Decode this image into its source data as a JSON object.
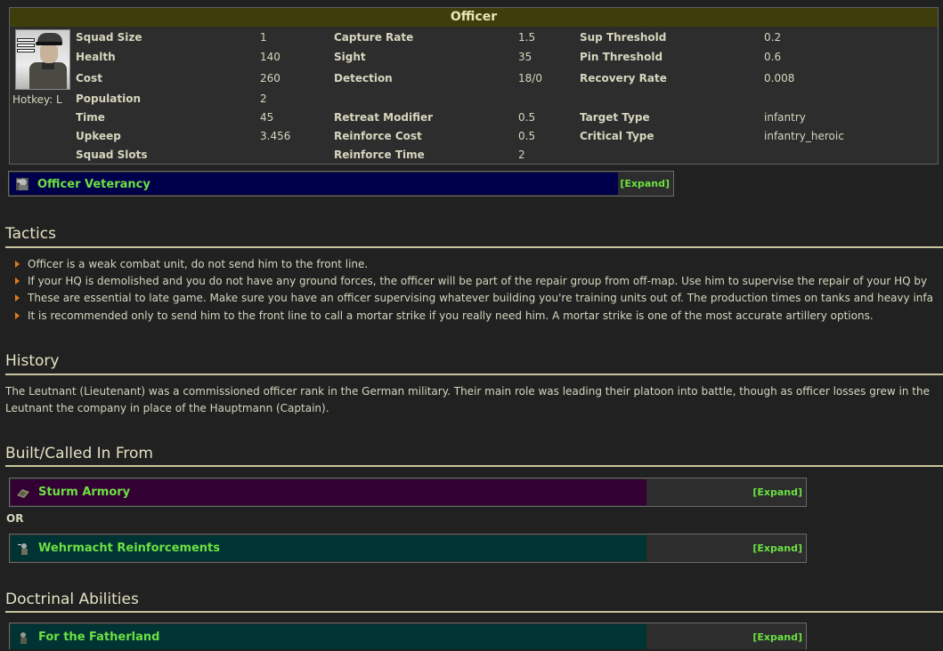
{
  "unit": {
    "title": "Officer",
    "hotkey": "Hotkey: L",
    "stats": {
      "col1": [
        {
          "label": "Squad Size",
          "value": "1"
        },
        {
          "label": "Health",
          "value": "140"
        },
        {
          "label": "Cost",
          "value": "260"
        },
        {
          "label": "Population",
          "value": "2"
        },
        {
          "label": "Time",
          "value": "45"
        },
        {
          "label": "Upkeep",
          "value": "3.456"
        },
        {
          "label": "Squad Slots",
          "value": ""
        }
      ],
      "col2": [
        {
          "label": "Capture Rate",
          "value": "1.5"
        },
        {
          "label": "Sight",
          "value": "35"
        },
        {
          "label": "Detection",
          "value": "18/0"
        },
        {
          "label": "Retreat Modifier",
          "value": "0.5"
        },
        {
          "label": "Reinforce Cost",
          "value": "0.5"
        },
        {
          "label": "Reinforce Time",
          "value": "2"
        }
      ],
      "col3": [
        {
          "label": "Sup Threshold",
          "value": "0.2"
        },
        {
          "label": "Pin Threshold",
          "value": "0.6"
        },
        {
          "label": "Recovery Rate",
          "value": "0.008"
        },
        {
          "label": "Target Type",
          "value": "infantry"
        },
        {
          "label": "Critical Type",
          "value": "infantry_heroic"
        }
      ]
    }
  },
  "veterancy": {
    "name": "Officer Veterancy",
    "expand": "[Expand]",
    "color": "#00004a"
  },
  "tactics": {
    "heading": "Tactics",
    "items": [
      "Officer is a weak combat unit, do not send him to the front line.",
      "If your HQ is demolished and you do not have any ground forces, the officer will be part of the repair group from off-map. Use him to supervise the repair of your HQ by",
      "These are essential to late game. Make sure you have an officer supervising whatever building you're training units out of. The production times on tanks and heavy infa",
      "It is recommended only to send him to the front line to call a mortar strike if you really need him. A mortar strike is one of the most accurate artillery options."
    ]
  },
  "history": {
    "heading": "History",
    "lines": [
      "The Leutnant (Lieutenant) was a commissioned officer rank in the German military. Their main role was leading their platoon into battle, though as officer losses grew in the",
      "Leutnant the company in place of the Hauptmann (Captain)."
    ]
  },
  "built": {
    "heading": "Built/Called In From",
    "or": "OR",
    "items": [
      {
        "name": "Sturm Armory",
        "expand": "[Expand]",
        "color": "#330033"
      },
      {
        "name": "Wehrmacht Reinforcements",
        "expand": "[Expand]",
        "color": "#003333"
      }
    ]
  },
  "doctrinal": {
    "heading": "Doctrinal Abilities",
    "items": [
      {
        "name": "For the Fatherland",
        "expand": "[Expand]",
        "color": "#003333"
      }
    ]
  }
}
